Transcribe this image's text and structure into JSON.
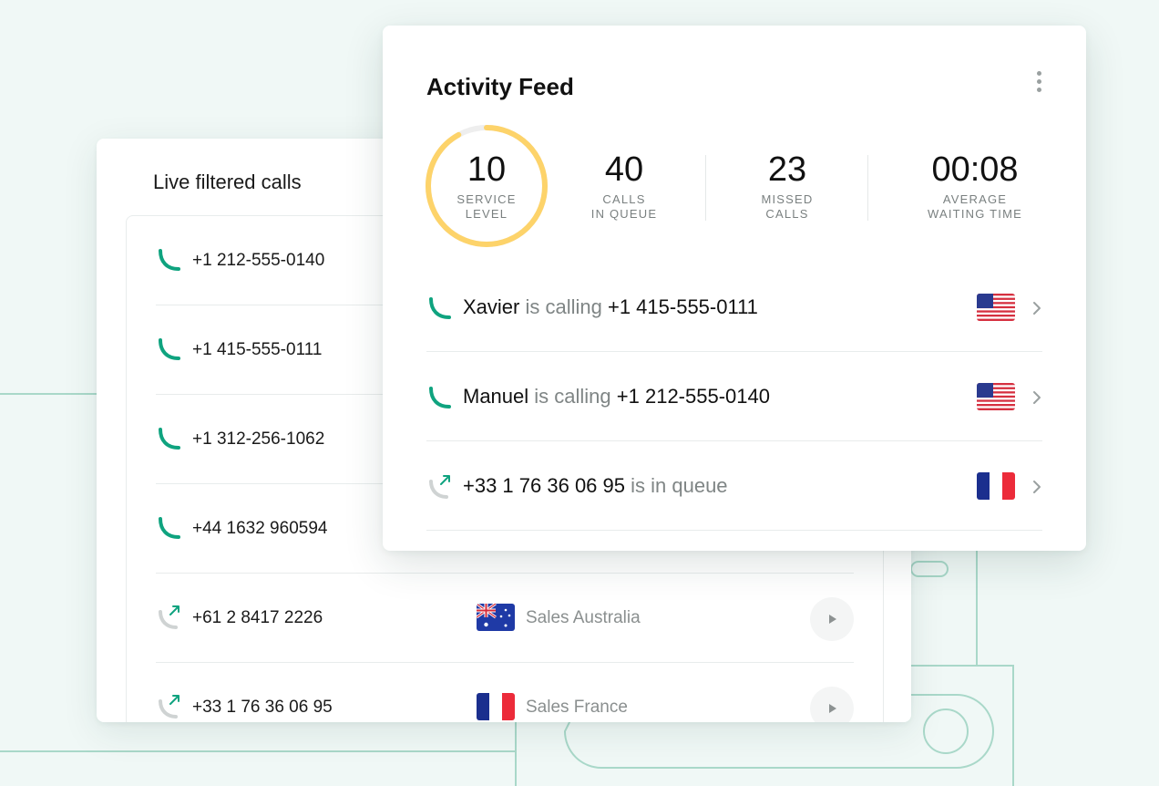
{
  "live_calls": {
    "title": "Live filtered calls",
    "rows": [
      {
        "number": "+1 212-555-0140",
        "type": "incoming",
        "team": "",
        "flag": ""
      },
      {
        "number": "+1 415-555-0111",
        "type": "incoming",
        "team": "",
        "flag": ""
      },
      {
        "number": "+1 312-256-1062",
        "type": "incoming",
        "team": "",
        "flag": ""
      },
      {
        "number": "+44 1632 960594",
        "type": "incoming",
        "team": "",
        "flag": ""
      },
      {
        "number": "+61 2 8417 2226",
        "type": "queued",
        "team": "Sales Australia",
        "flag": "australia-flag"
      },
      {
        "number": "+33 1 76 36 06 95",
        "type": "queued",
        "team": "Sales France",
        "flag": "france-flag"
      }
    ]
  },
  "activity_feed": {
    "title": "Activity Feed",
    "stats": [
      {
        "value": "10",
        "label_1": "SERVICE",
        "label_2": "LEVEL"
      },
      {
        "value": "40",
        "label_1": "CALLS",
        "label_2": "IN QUEUE"
      },
      {
        "value": "23",
        "label_1": "MISSED",
        "label_2": "CALLS"
      },
      {
        "value": "00:08",
        "label_1": "AVERAGE",
        "label_2": "WAITING TIME"
      }
    ],
    "service_level_fraction": 0.92,
    "events": [
      {
        "name": "Xavier",
        "action": "is calling",
        "number": "+1 415-555-0111",
        "flag": "usa-flag",
        "type": "incoming"
      },
      {
        "name": "Manuel",
        "action": "is calling",
        "number": "+1 212-555-0140",
        "flag": "usa-flag",
        "type": "incoming"
      },
      {
        "name": "",
        "action": "is in queue",
        "number": "+33 1 76 36 06 95",
        "flag": "france-flag",
        "type": "queued"
      }
    ]
  },
  "colors": {
    "accent_green": "#0fa37f",
    "ring_yellow": "#fdd36a",
    "background": "#f0f8f6",
    "line_green": "#9fd4c4"
  }
}
